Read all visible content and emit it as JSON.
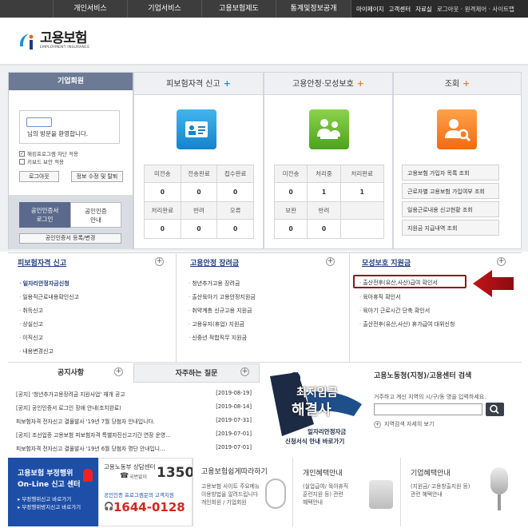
{
  "topnav": {
    "items": [
      "개인서비스",
      "기업서비스",
      "고용보험제도",
      "통계및정보공개"
    ],
    "right": [
      "마이페이지",
      "고객센터",
      "자료실",
      "로그아웃 · 원격제어 · 사이트맵"
    ]
  },
  "logo": {
    "ko": "고용보험",
    "en": "EMPLOYMENT INSURANCE"
  },
  "login": {
    "title": "기업회원",
    "welcome": "님의 방문을 환영합니다.",
    "opt1": "해킹프로그램 차단 적용",
    "opt2": "키보드 보안 적용",
    "logout": "로그아웃",
    "edit": "정보 수정 및 탈퇴",
    "cert_login": "공인인증서\n로그인",
    "cert_info": "공인인증\n안내",
    "cert_reg": "공인인증서 등록/변경"
  },
  "panels": {
    "p1": {
      "title": "피보험자격 신고",
      "headers1": [
        "미전송",
        "전송완료",
        "접수완료"
      ],
      "vals1": [
        "0",
        "0",
        "0"
      ],
      "headers2": [
        "처리완료",
        "반려",
        "오류"
      ],
      "vals2": [
        "0",
        "0",
        "0"
      ]
    },
    "p2": {
      "title": "고용안정·모성보호",
      "headers1": [
        "미전송",
        "처리중",
        "처리완료"
      ],
      "vals1": [
        "0",
        "1",
        "1"
      ],
      "headers2": [
        "보완",
        "반려",
        ""
      ],
      "vals2": [
        "0",
        "0",
        ""
      ]
    },
    "p3": {
      "title": "조회",
      "items": [
        "고용보험 가입자 목록 조회",
        "근로자별 고용보험 가입여부 조회",
        "일용근로내용 신고현황 조회",
        "지원금 지급내역 조회"
      ]
    }
  },
  "plus": "+",
  "sections": {
    "s1": {
      "title": "피보험자격 신고",
      "items": [
        "일자리안정자금신청",
        "일용직근로내용확인신고",
        "취득신고",
        "상실신고",
        "이직신고",
        "내용변경신고"
      ]
    },
    "s2": {
      "title": "고용안정 장려금",
      "items": [
        "청년추가고용 장려금",
        "출산육아기 고용안정지원금",
        "취약계층 신규고용 지원금",
        "고용유지(휴업) 지원금",
        "신중년 적합직무 지원금"
      ]
    },
    "s3": {
      "title": "모성보호 지원금",
      "items": [
        "출산전후(유산,사산)급여 확인서",
        "육아휴직 확인서",
        "육아기 근로시간 단축 확인서",
        "출산전후(유산,사산) 휴가급여 대위신청"
      ]
    }
  },
  "notice": {
    "tab1": "공지사항",
    "tab2": "자주하는 질문",
    "rows": [
      {
        "t": "[공지] '청년추가고용장려금 지원사업' 재개 공고",
        "d": "[2019-08-19]"
      },
      {
        "t": "[공지] 공인인증서 로그인 장애 안내(조치완료)",
        "d": "[2019-08-14]"
      },
      {
        "t": "피보험자격 전자신고 결물발사 '19년 7월 당첨자 안내입니다.",
        "d": "[2019-07-31]"
      },
      {
        "t": "[공지] 조선업종 고용보험 피보험자격 특별자진신고기간 연장 운영...",
        "d": "[2019-07-01]"
      },
      {
        "t": "피보험자격 전자신고 결물발사 '19년 6월 당첨자 명단 안내입니...",
        "d": "[2019-07-01]"
      }
    ]
  },
  "banner": {
    "l1": "최저임금",
    "l2": "해결사",
    "sub1": "일자리안정자금",
    "sub2": "신청서식 안내 바로가기"
  },
  "office": {
    "title": "고용노동청(지청)/고용센터 검색",
    "desc": "거주하고 계신 지역의 시/구/동 명을 입력하세요.",
    "detail": "지역검색 자세히 보기"
  },
  "footer": {
    "f1": {
      "l1": "고용보험 부정행위",
      "l2": "On-Line 신고 센터",
      "l3": "▸ 부정행위신고 바로가기",
      "l4": "▸ 부정행위방지신고 바로가기"
    },
    "f2": {
      "l1": "고용노동부 상담센터",
      "num": "1350",
      "mob": "국번없이",
      "l2": "공인인증 프로그램문의 고객지원",
      "num2": "1644-0128"
    },
    "f3": {
      "title": "고용보험쉽게따라하기",
      "d1": "고용보험 사이트 주요메뉴",
      "d2": "이용방법을 알려드립니다",
      "d3": "개인회원 / 기업회원"
    },
    "f4": {
      "title": "개인혜택안내",
      "d1": "(실업급여/ 육아휴직",
      "d2": "훈련지원 등) 관련",
      "d3": "혜택안내"
    },
    "f5": {
      "title": "기업혜택안내",
      "d1": "(지원금/ 고용창출지원 등)",
      "d2": "관련 혜택안내"
    }
  },
  "colors": {
    "accent": "#1f3d7a",
    "orange": "#e08a1e",
    "highlight": "#8b1a1a"
  }
}
